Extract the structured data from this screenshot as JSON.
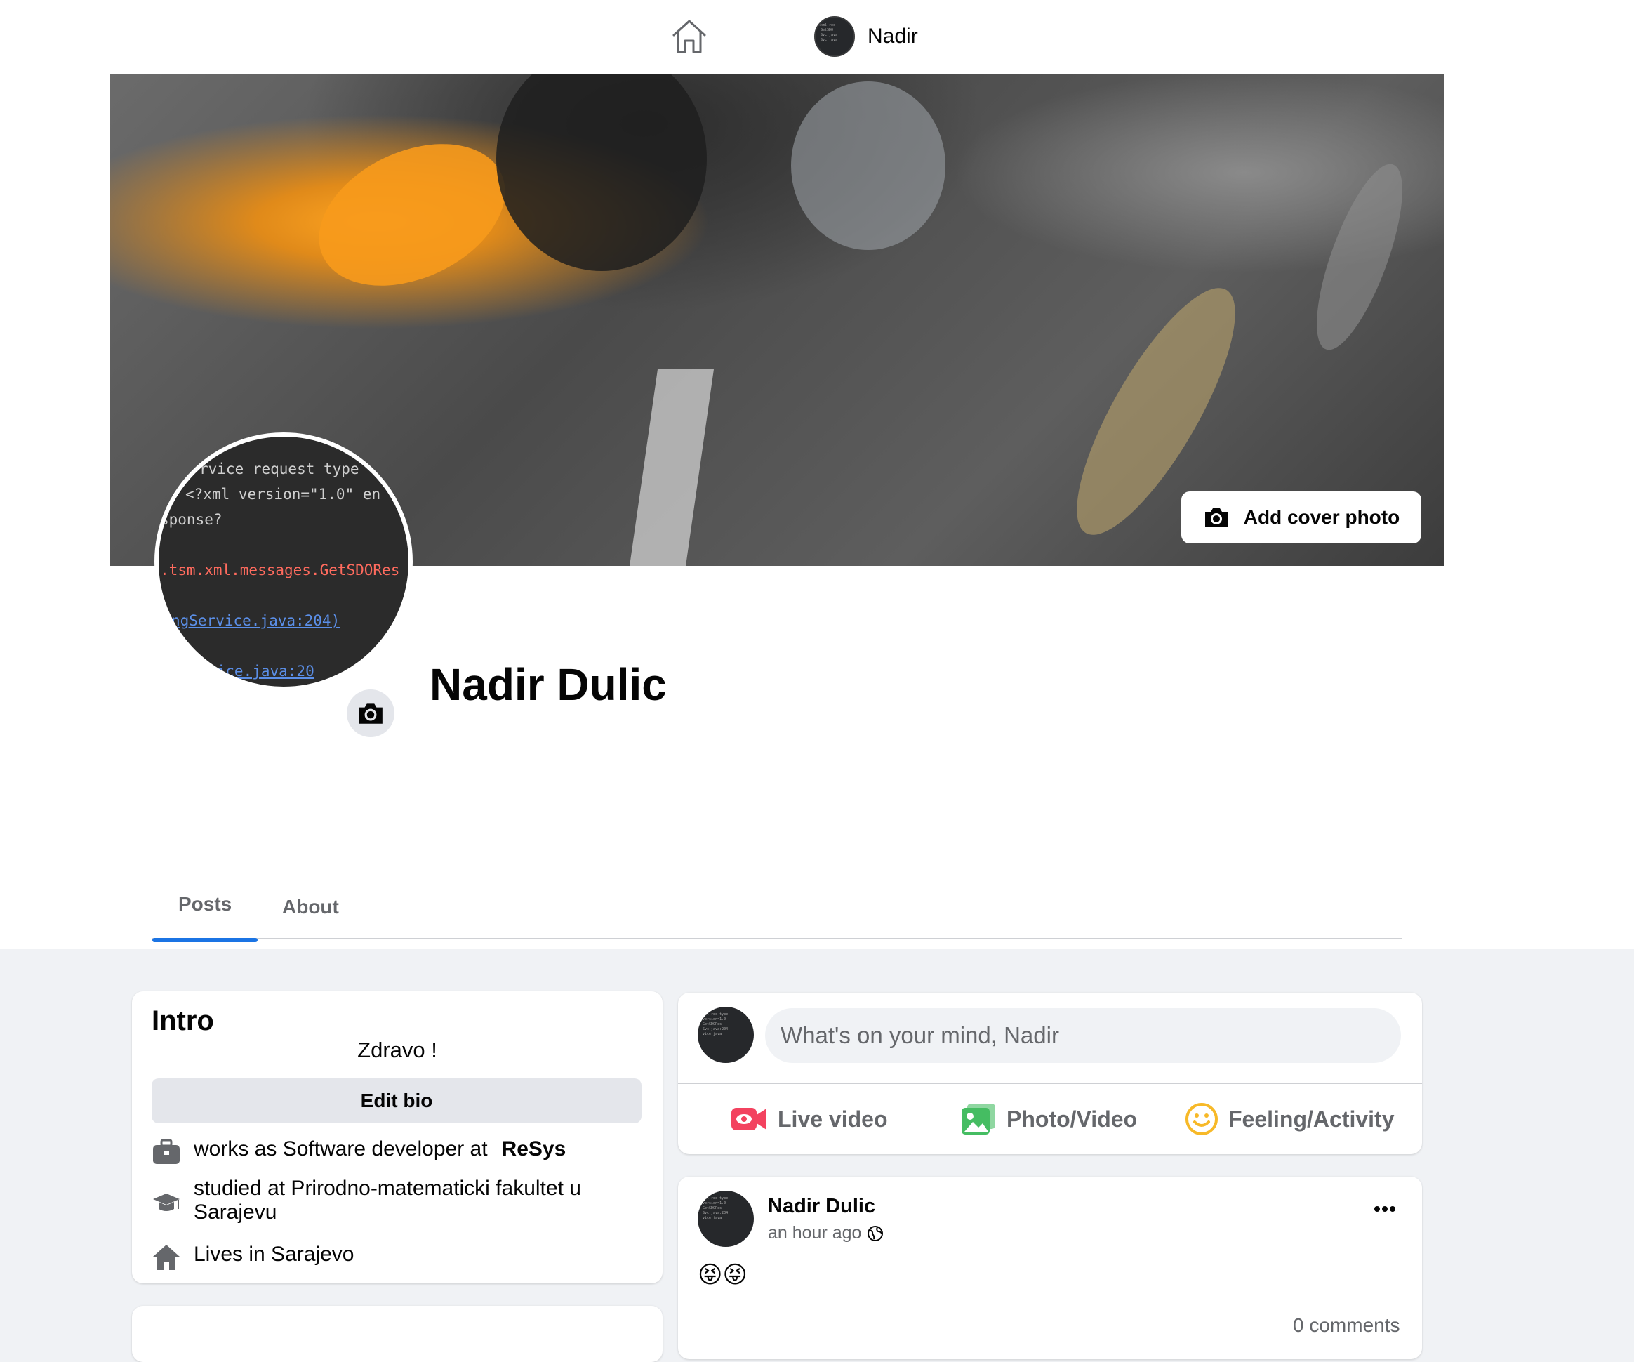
{
  "topbar": {
    "home_icon": "home-icon",
    "profile_name": "Nadir"
  },
  "profile": {
    "name": "Nadir Dulic",
    "cover_button_label": "Add cover photo",
    "avatar_code_lines": [
      "rvice request type",
      "<?xml version=\"1.0\" en",
      "sponse?",
      ".tsm.xml.messages.GetSDORes",
      "ngService.java:204)",
      "vice.java:20"
    ],
    "tabs": [
      "Posts",
      "About"
    ],
    "active_tab": "Posts"
  },
  "intro": {
    "title": "Intro",
    "bio": "Zdravo !",
    "edit_bio_label": "Edit bio",
    "work_text": "works as Software developer at",
    "work_company": "ReSys",
    "study_text": "studied at Prirodno-matematicki fakultet u Sarajevu",
    "lives_text": "Lives in Sarajevo"
  },
  "composer": {
    "placeholder": "What's on your mind, Nadir",
    "actions": [
      "Live video",
      "Photo/Video",
      "Feeling/Activity"
    ]
  },
  "post": {
    "author": "Nadir Dulic",
    "time": "an hour ago",
    "body": "😝😝",
    "comments": "0 comments"
  },
  "colors": {
    "accent": "#1b74e4",
    "live": "#f3425f",
    "photo": "#45bd62",
    "feeling": "#f7b928"
  }
}
